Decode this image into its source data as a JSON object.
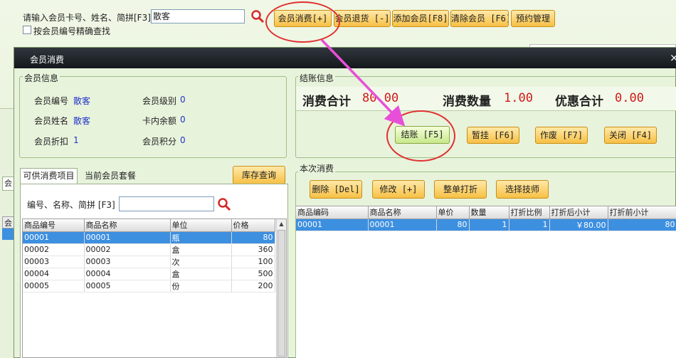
{
  "topbar": {
    "search_label": "请输入会员卡号、姓名、简拼[F3]",
    "search_value": "散客",
    "exact_match_label": "按会员编号精确查找",
    "buttons": [
      "会员消费[+]",
      "会员退货 [-]",
      "添加会员[F8]",
      "清除会员 [F6]",
      "预约管理"
    ]
  },
  "dialog": {
    "title": "会员消费",
    "close": "×",
    "member_info": {
      "title": "会员信息",
      "fields": [
        {
          "label": "会员编号",
          "value": "散客"
        },
        {
          "label": "会员级别",
          "value": "0"
        },
        {
          "label": "会员姓名",
          "value": "散客"
        },
        {
          "label": "卡内余额",
          "value": "0"
        },
        {
          "label": "会员折扣",
          "value": "1"
        },
        {
          "label": "会员积分",
          "value": "0"
        }
      ]
    },
    "settlement": {
      "title": "结账信息",
      "total_label": "消费合计",
      "total_value": "80.00",
      "qty_label": "消费数量",
      "qty_value": "1.00",
      "discount_label": "优惠合计",
      "discount_value": "0.00",
      "checkout": "结账 [F5]",
      "hold": "暂挂 [F6]",
      "void": "作废 [F7]",
      "close": "关闭 [F4]"
    },
    "products": {
      "tabs": [
        "可供消费项目",
        "当前会员套餐"
      ],
      "inventory_button": "库存查询",
      "search_label": "编号、名称、简拼 [F3]",
      "search_value": "",
      "columns": [
        "商品编号",
        "商品名称",
        "单位",
        "价格"
      ],
      "rows": [
        [
          "00001",
          "00001",
          "瓶",
          "80"
        ],
        [
          "00002",
          "00002",
          "盒",
          "360"
        ],
        [
          "00003",
          "00003",
          "次",
          "100"
        ],
        [
          "00004",
          "00004",
          "盒",
          "500"
        ],
        [
          "00005",
          "00005",
          "份",
          "200"
        ]
      ]
    },
    "current": {
      "title": "本次消费",
      "buttons": [
        "删除 [Del]",
        "修改 [+]",
        "整单打折",
        "选择技师"
      ],
      "columns": [
        "商品编码",
        "商品名称",
        "单价",
        "数量",
        "打折比例",
        "打折后小计",
        "打折前小计"
      ],
      "rows": [
        [
          "00001",
          "00001",
          "80",
          "1",
          "1",
          "￥80.00",
          "80"
        ]
      ]
    }
  },
  "background": {
    "left_tab_fragment": "会",
    "left_header_fragment": "会"
  },
  "colors": {
    "accent_orange": "#f7c045",
    "selection_blue": "#3d8fe0",
    "amount_red": "#d11a1a",
    "annotation_red": "#e03030",
    "arrow_magenta": "#e84fd8"
  }
}
